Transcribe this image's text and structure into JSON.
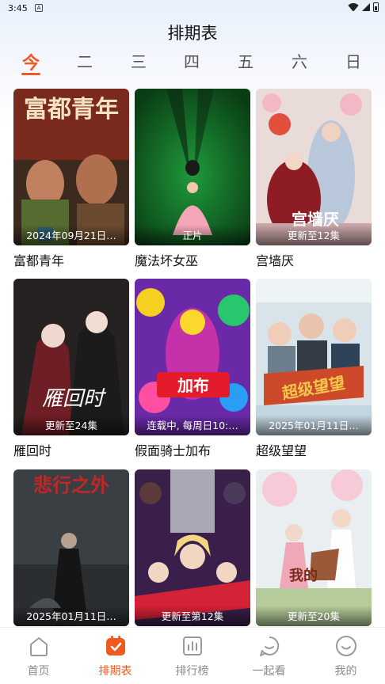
{
  "status_bar": {
    "time": "3:45",
    "notification_badge": "A"
  },
  "header": {
    "title": "排期表"
  },
  "day_tabs": [
    {
      "label": "今",
      "active": true
    },
    {
      "label": "二",
      "active": false
    },
    {
      "label": "三",
      "active": false
    },
    {
      "label": "四",
      "active": false
    },
    {
      "label": "五",
      "active": false
    },
    {
      "label": "六",
      "active": false
    },
    {
      "label": "日",
      "active": false
    }
  ],
  "shows": [
    {
      "title": "富都青年",
      "caption": "2024年09月21日…",
      "poster_text": "富都青年"
    },
    {
      "title": "魔法坏女巫",
      "caption": "正片"
    },
    {
      "title": "宫墙厌",
      "caption": "更新至12集",
      "poster_text": "宫墙厌"
    },
    {
      "title": "雁回时",
      "caption": "更新至24集",
      "poster_text": "雁回时"
    },
    {
      "title": "假面骑士加布",
      "caption": "连载中, 每周日10:…",
      "poster_text": "加布"
    },
    {
      "title": "超级望望",
      "caption": "2025年01月11日…",
      "poster_text": "超级望望"
    },
    {
      "title": "",
      "caption": "2025年01月11日…",
      "poster_text": "悲行之外"
    },
    {
      "title": "",
      "caption": "更新至第12集"
    },
    {
      "title": "",
      "caption": "更新至20集",
      "poster_text": "我的"
    }
  ],
  "bottom_nav": [
    {
      "label": "首页",
      "icon": "home-icon",
      "active": false
    },
    {
      "label": "排期表",
      "icon": "calendar-check-icon",
      "active": true
    },
    {
      "label": "排行榜",
      "icon": "chart-icon",
      "active": false
    },
    {
      "label": "一起看",
      "icon": "chat-icon",
      "active": false
    },
    {
      "label": "我的",
      "icon": "profile-icon",
      "active": false
    }
  ],
  "colors": {
    "accent": "#ee5a1f",
    "inactive": "#8a8a8a"
  }
}
